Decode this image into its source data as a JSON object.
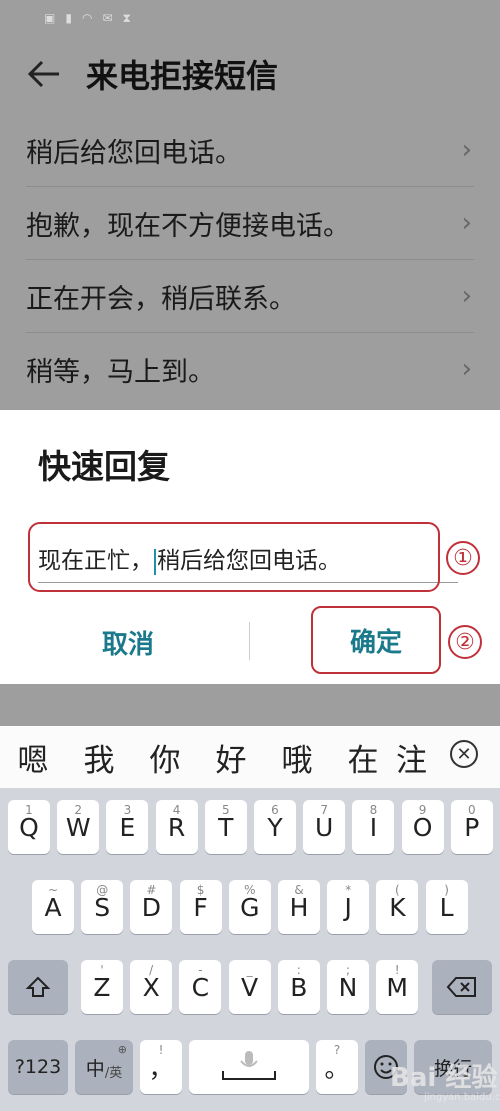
{
  "app": {
    "title": "来电拒接短信",
    "replies": [
      {
        "text": "稍后给您回电话。"
      },
      {
        "text": "抱歉，现在不方便接电话。"
      },
      {
        "text": "正在开会，稍后联系。"
      },
      {
        "text": "稍等，马上到。"
      }
    ]
  },
  "dialog": {
    "title": "快速回复",
    "input_before_caret": "现在正忙，",
    "input_after_caret": "稍后给您回电话。",
    "cancel_label": "取消",
    "ok_label": "确定",
    "callout_input": "①",
    "callout_ok": "②"
  },
  "keyboard": {
    "candidates": [
      "嗯",
      "我",
      "你",
      "好",
      "哦",
      "在",
      "注"
    ],
    "row1": [
      {
        "k": "Q",
        "s": "1"
      },
      {
        "k": "W",
        "s": "2"
      },
      {
        "k": "E",
        "s": "3"
      },
      {
        "k": "R",
        "s": "4"
      },
      {
        "k": "T",
        "s": "5"
      },
      {
        "k": "Y",
        "s": "6"
      },
      {
        "k": "U",
        "s": "7"
      },
      {
        "k": "I",
        "s": "8"
      },
      {
        "k": "O",
        "s": "9"
      },
      {
        "k": "P",
        "s": "0"
      }
    ],
    "row2": [
      {
        "k": "A",
        "s": "~"
      },
      {
        "k": "S",
        "s": "@"
      },
      {
        "k": "D",
        "s": "#"
      },
      {
        "k": "F",
        "s": "$"
      },
      {
        "k": "G",
        "s": "%"
      },
      {
        "k": "H",
        "s": "&"
      },
      {
        "k": "J",
        "s": "*"
      },
      {
        "k": "K",
        "s": "("
      },
      {
        "k": "L",
        "s": ")"
      }
    ],
    "row3": [
      {
        "k": "Z",
        "s": "'"
      },
      {
        "k": "X",
        "s": "/"
      },
      {
        "k": "C",
        "s": "-"
      },
      {
        "k": "V",
        "s": "_"
      },
      {
        "k": "B",
        "s": ":"
      },
      {
        "k": "N",
        "s": ";"
      },
      {
        "k": "M",
        "s": "!"
      }
    ],
    "num_label": "?123",
    "lang_main": "中",
    "lang_sub": "/英",
    "comma_main": "，",
    "comma_sub": "!",
    "period_main": "。",
    "period_sub": "?",
    "enter_label": "换行"
  },
  "watermark": {
    "main": "Bai 经验",
    "sub": "jingyan.baidu.com"
  }
}
